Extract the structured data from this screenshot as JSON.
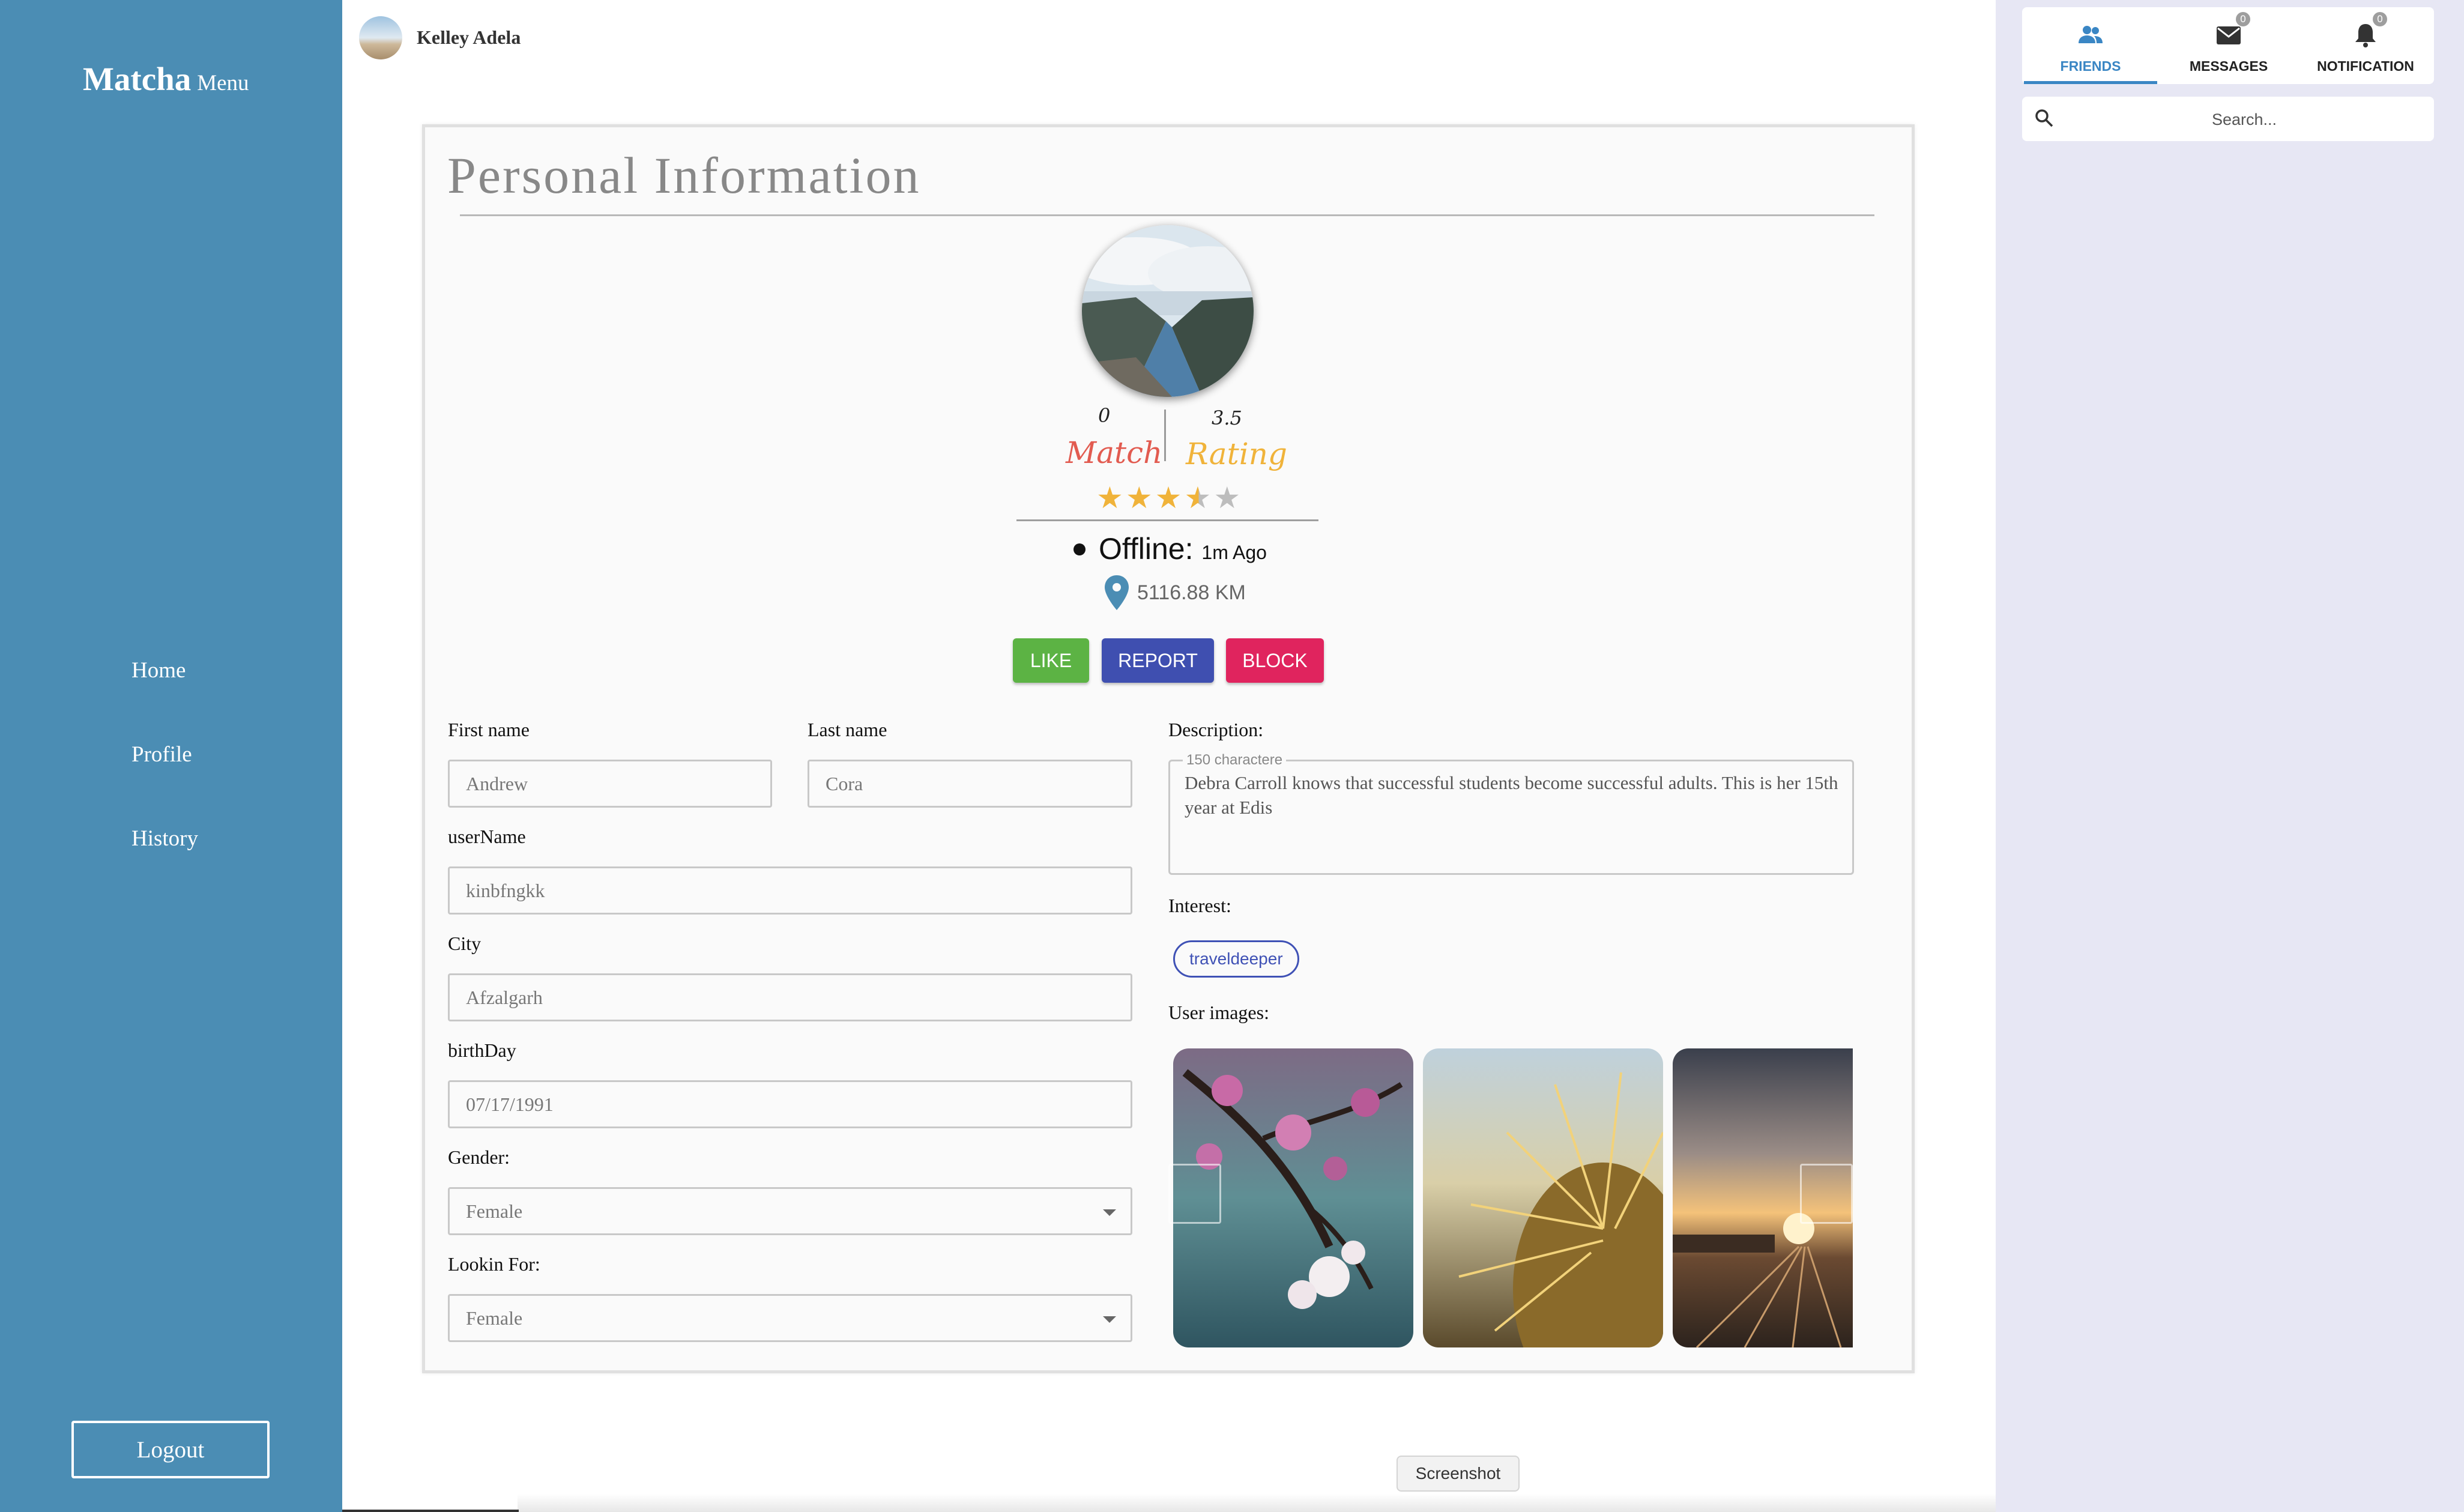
{
  "sidebar": {
    "brand": "Matcha",
    "brand_sub": "Menu",
    "nav": [
      {
        "label": "Home"
      },
      {
        "label": "Profile"
      },
      {
        "label": "History"
      }
    ],
    "logout_label": "Logout",
    "color": "#4b8db4"
  },
  "top_user": {
    "name": "Kelley Adela"
  },
  "card": {
    "title": "Personal Information",
    "stats": {
      "match_count": "0",
      "match_label": "Match",
      "rating_value": "3.5",
      "rating_label": "Rating",
      "stars_filled": 3.5,
      "stars_total": 5,
      "match_color": "#e25b50",
      "rating_color": "#f0b33a"
    },
    "status": {
      "label": "Offline:",
      "ago": "1m Ago"
    },
    "distance": "5116.88 KM",
    "actions": {
      "like": "LIKE",
      "report": "REPORT",
      "block": "BLOCK"
    },
    "form": {
      "first_name_label": "First name",
      "first_name_value": "Andrew",
      "last_name_label": "Last name",
      "last_name_value": "Cora",
      "username_label": "userName",
      "username_value": "kinbfngkk",
      "city_label": "City",
      "city_value": "Afzalgarh",
      "birthday_label": "birthDay",
      "birthday_value": "07/17/1991",
      "gender_label": "Gender:",
      "gender_value": "Female",
      "looking_label": "Lookin For:",
      "looking_value": "Female"
    },
    "description": {
      "label": "Description:",
      "legend": "150 charactere",
      "text": "Debra Carroll knows that successful students become successful adults. This is her 15th year at Edis"
    },
    "interest": {
      "label": "Interest:",
      "tags": [
        "traveldeeper"
      ]
    },
    "user_images_label": "User images:"
  },
  "right_panel": {
    "tabs": [
      {
        "label": "FRIENDS",
        "icon": "people-icon",
        "active": true
      },
      {
        "label": "MESSAGES",
        "icon": "mail-icon",
        "badge": "0"
      },
      {
        "label": "NOTIFICATION",
        "icon": "bell-icon",
        "badge": "0"
      }
    ],
    "search_placeholder": "Search...",
    "accent": "#3a86c4"
  },
  "tooltip": "Screenshot"
}
